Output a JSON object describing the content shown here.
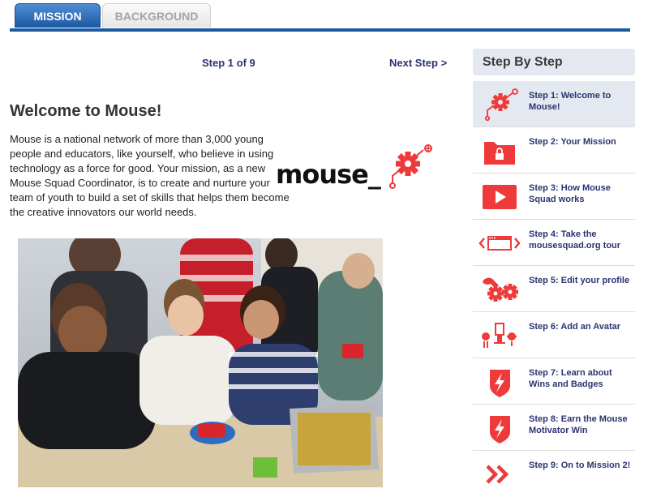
{
  "tabs": [
    {
      "label": "MISSION",
      "active": true
    },
    {
      "label": "BACKGROUND",
      "active": false
    }
  ],
  "main": {
    "step_counter": "Step 1 of 9",
    "next_label": "Next Step >",
    "title": "Welcome to Mouse!",
    "intro": "Mouse is a national network of more than 3,000 young people and educators, like yourself, who believe in using technology as a force for good. Your mission, as a new Mouse Squad Coordinator, is to create and nurture your team of youth to build a set of skills that helps them become the creative innovators our world needs.",
    "logo_text": "mouse_"
  },
  "sidebar": {
    "title": "Step By Step",
    "steps": [
      {
        "label": "Step 1: Welcome to Mouse!",
        "icon": "gear-icon",
        "active": true
      },
      {
        "label": "Step 2: Your Mission",
        "icon": "locked-folder-icon",
        "active": false
      },
      {
        "label": "Step 3: How Mouse Squad works",
        "icon": "play-icon",
        "active": false
      },
      {
        "label": "Step 4: Take the mousesquad.org tour",
        "icon": "browser-code-icon",
        "active": false
      },
      {
        "label": "Step 5: Edit your profile",
        "icon": "wrench-gear-icon",
        "active": false
      },
      {
        "label": "Step 6: Add an Avatar",
        "icon": "avatar-robot-icon",
        "active": false
      },
      {
        "label": "Step 7: Learn about Wins and Badges",
        "icon": "badge-shield-icon",
        "active": false
      },
      {
        "label": "Step 8: Earn the Mouse Motivator Win",
        "icon": "badge-shield-icon",
        "active": false
      },
      {
        "label": "Step 9: On to Mission 2!",
        "icon": "double-chevron-icon",
        "active": false
      }
    ]
  },
  "colors": {
    "accent_blue": "#1d5aa5",
    "link_navy": "#2c3470",
    "icon_red": "#ee3a3a",
    "sidebar_bg": "#e4e8f0"
  }
}
